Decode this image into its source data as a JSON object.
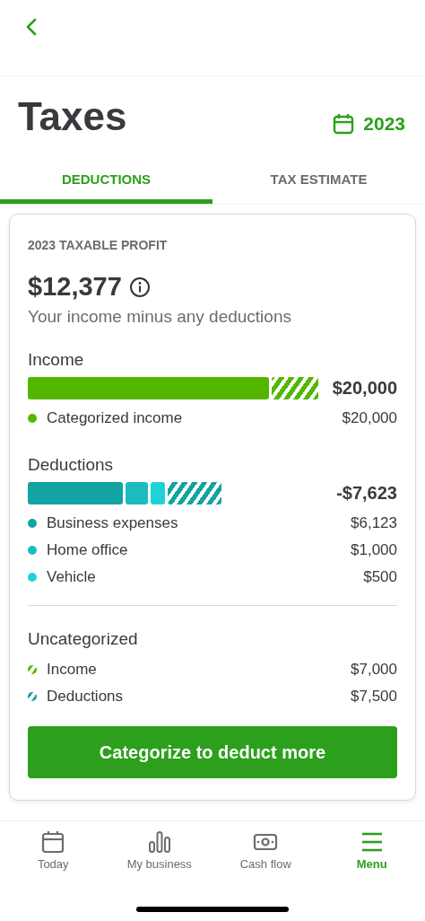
{
  "header": {
    "title": "Taxes",
    "year": "2023"
  },
  "tabs": [
    {
      "label": "DEDUCTIONS",
      "selected": true
    },
    {
      "label": "TAX ESTIMATE",
      "selected": false
    }
  ],
  "card": {
    "heading": "2023 TAXABLE PROFIT",
    "amount": "$12,377",
    "caption": "Your income minus any deductions",
    "sections": [
      {
        "title": "Income",
        "total": "$20,000",
        "segments": [
          {
            "kind": "solid",
            "color": "#53b700"
          },
          {
            "kind": "hatched",
            "color": "#53b700"
          }
        ],
        "items": [
          {
            "label": "Categorized income",
            "value": "$20,000",
            "kind": "solid",
            "color": "#53b700"
          }
        ]
      },
      {
        "title": "Deductions",
        "total": "-$7,623",
        "segments": [
          {
            "kind": "solid",
            "color": "#12a3a3"
          },
          {
            "kind": "solid",
            "color": "#1bbcc0"
          },
          {
            "kind": "solid",
            "color": "#1fd2d8"
          },
          {
            "kind": "hatched",
            "color": "#12a3a3"
          }
        ],
        "items": [
          {
            "label": "Business expenses",
            "value": "$6,123",
            "kind": "solid",
            "color": "#12a3a3"
          },
          {
            "label": "Home office",
            "value": "$1,000",
            "kind": "solid",
            "color": "#1bbcc0"
          },
          {
            "label": "Vehicle",
            "value": "$500",
            "kind": "solid",
            "color": "#1fd2d8"
          }
        ]
      }
    ],
    "uncategorized": {
      "title": "Uncategorized",
      "items": [
        {
          "label": "Income",
          "value": "$7,000",
          "kind": "hatched",
          "color": "#53b700"
        },
        {
          "label": "Deductions",
          "value": "$7,500",
          "kind": "hatched",
          "color": "#12a3a3"
        }
      ]
    },
    "button": "Categorize to deduct more"
  },
  "nav": [
    {
      "label": "Today",
      "selected": false
    },
    {
      "label": "My business",
      "selected": false
    },
    {
      "label": "Cash flow",
      "selected": false
    },
    {
      "label": "Menu",
      "selected": true
    }
  ]
}
